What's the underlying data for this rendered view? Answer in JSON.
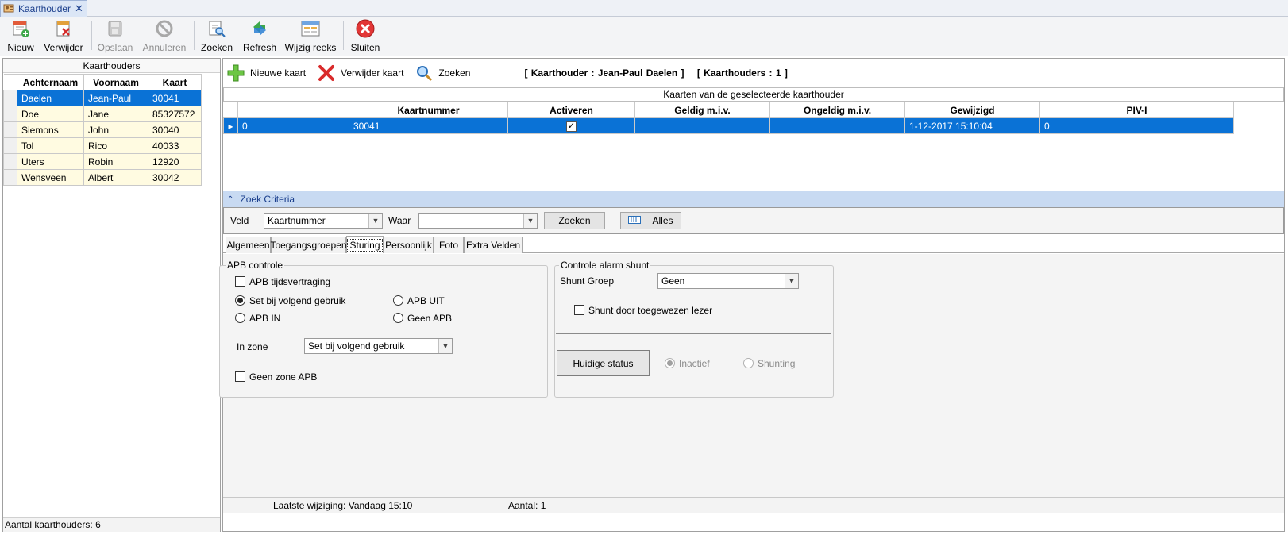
{
  "window": {
    "tab_title": "Kaarthouder"
  },
  "toolbar": {
    "new": "Nieuw",
    "delete": "Verwijder",
    "save": "Opslaan",
    "cancel": "Annuleren",
    "search": "Zoeken",
    "refresh": "Refresh",
    "edit_range": "Wijzig reeks",
    "close": "Sluiten"
  },
  "left": {
    "title": "Kaarthouders",
    "columns": [
      "Achternaam",
      "Voornaam",
      "Kaart"
    ],
    "rows": [
      [
        "Daelen",
        "Jean-Paul",
        "30041"
      ],
      [
        "Doe",
        "Jane",
        "85327572"
      ],
      [
        "Siemons",
        "John",
        "30040"
      ],
      [
        "Tol",
        "Rico",
        "40033"
      ],
      [
        "Uters",
        "Robin",
        "12920"
      ],
      [
        "Wensveen",
        "Albert",
        "30042"
      ]
    ],
    "status": "Aantal kaarthouders: 6"
  },
  "cards_toolbar": {
    "new_card": "Nieuwe kaart",
    "delete_card": "Verwijder kaart",
    "search": "Zoeken",
    "info_holder": "[ Kaarthouder : Jean-Paul Daelen ]",
    "info_count": "[ Kaarthouders : 1 ]"
  },
  "cards": {
    "title": "Kaarten van de geselecteerde kaarthouder",
    "columns": [
      "",
      "Kaartnummer",
      "Activeren",
      "Geldig m.i.v.",
      "Ongeldig m.i.v.",
      "Gewijzigd",
      "PIV-I"
    ],
    "row": {
      "id": "0",
      "kaartnummer": "30041",
      "activeren": "✓",
      "geldig": "",
      "ongeldig": "",
      "gewijzigd": "1-12-2017 15:10:04",
      "piv": "0"
    }
  },
  "zoek": {
    "header": "Zoek Criteria",
    "veld_label": "Veld",
    "veld_value": "Kaartnummer",
    "waar_label": "Waar",
    "waar_value": "",
    "search_btn": "Zoeken",
    "all_btn": "Alles"
  },
  "tabs": [
    "Algemeen",
    "Toegangsgroepen",
    "Sturing",
    "Persoonlijk",
    "Foto",
    "Extra Velden"
  ],
  "sturing": {
    "apb_group": "APB controle",
    "apb_delay": "APB tijdsvertraging",
    "set_next_use": "Set bij volgend gebruik",
    "apb_out": "APB UIT",
    "apb_in": "APB IN",
    "no_apb": "Geen APB",
    "zone_label": "In zone",
    "zone_value": "Set bij volgend gebruik",
    "no_zone_apb": "Geen zone APB",
    "shunt_group_title": "Controle alarm shunt",
    "shunt_group_label": "Shunt Groep",
    "shunt_group_value": "Geen",
    "shunt_reader": "Shunt door toegewezen lezer",
    "status_btn": "Huidige status",
    "inactive": "Inactief",
    "shunting": "Shunting"
  },
  "status_bar": {
    "last_change": "Laatste wijziging: Vandaag 15:10",
    "count": "Aantal: 1"
  }
}
